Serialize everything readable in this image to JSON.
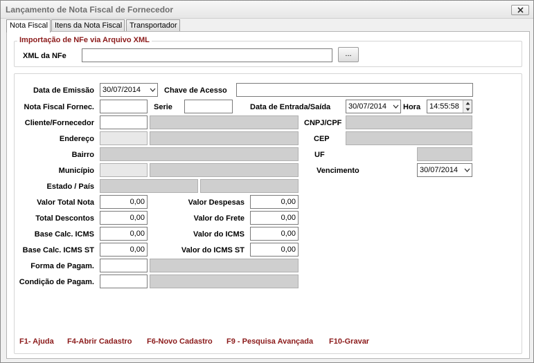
{
  "window": {
    "title": "Lançamento de Nota Fiscal de Fornecedor"
  },
  "tabs": [
    {
      "label": "Nota Fiscal"
    },
    {
      "label": "Itens da Nota Fiscal"
    },
    {
      "label": "Transportador"
    }
  ],
  "xml_group": {
    "title": "Importação de NFe via Arquivo XML",
    "xml_label": "XML da NFe",
    "xml_value": "",
    "browse_label": "..."
  },
  "form": {
    "data_emissao": {
      "label": "Data de Emissão",
      "value": "30/07/2014"
    },
    "chave_acesso": {
      "label": "Chave de Acesso",
      "value": ""
    },
    "nf_fornec": {
      "label": "Nota Fiscal Fornec.",
      "value": ""
    },
    "serie": {
      "label": "Serie",
      "value": ""
    },
    "data_entrada": {
      "label": "Data de Entrada/Saída",
      "value": "30/07/2014"
    },
    "hora": {
      "label": "Hora",
      "value": "14:55:58"
    },
    "cliente": {
      "label": "Cliente/Fornecedor",
      "code": "",
      "name": ""
    },
    "cnpj": {
      "label": "CNPJ/CPF",
      "value": ""
    },
    "endereco": {
      "label": "Endereço",
      "num": "",
      "street": ""
    },
    "cep": {
      "label": "CEP",
      "value": ""
    },
    "bairro": {
      "label": "Bairro",
      "value": ""
    },
    "uf": {
      "label": "UF",
      "value": ""
    },
    "municipio": {
      "label": "Município",
      "code": "",
      "name": ""
    },
    "vencimento": {
      "label": "Vencimento",
      "value": "30/07/2014"
    },
    "estado_pais": {
      "label": "Estado / País",
      "estado": "",
      "pais": ""
    },
    "valor_total": {
      "label": "Valor Total Nota",
      "value": "0,00"
    },
    "valor_despesas": {
      "label": "Valor Despesas",
      "value": "0,00"
    },
    "total_descontos": {
      "label": "Total Descontos",
      "value": "0,00"
    },
    "valor_frete": {
      "label": "Valor do Frete",
      "value": "0,00"
    },
    "base_icms": {
      "label": "Base Calc. ICMS",
      "value": "0,00"
    },
    "valor_icms": {
      "label": "Valor do ICMS",
      "value": "0,00"
    },
    "base_icms_st": {
      "label": "Base Calc. ICMS ST",
      "value": "0,00"
    },
    "valor_icms_st": {
      "label": "Valor do ICMS ST",
      "value": "0,00"
    },
    "forma_pagam": {
      "label": "Forma de Pagam.",
      "code": "",
      "name": ""
    },
    "condicao_pagam": {
      "label": "Condição de Pagam.",
      "code": "",
      "name": ""
    }
  },
  "shortcuts": [
    {
      "label": "F1- Ajuda"
    },
    {
      "label": "F4-Abrir Cadastro"
    },
    {
      "label": "F6-Novo Cadastro"
    },
    {
      "label": "F9 - Pesquisa Avançada"
    },
    {
      "label": "F10-Gravar"
    }
  ],
  "colors": {
    "accent": "#8b1a1a",
    "readonly": "#cfcfcf"
  }
}
